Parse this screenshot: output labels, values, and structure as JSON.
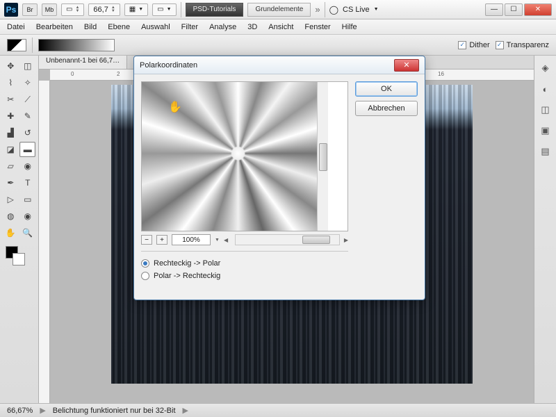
{
  "titlebar": {
    "logo": "Ps",
    "zoom": "66,7",
    "tab_active": "PSD-Tutorials",
    "tab2": "Grundelemente",
    "cslive": "CS Live"
  },
  "menu": [
    "Datei",
    "Bearbeiten",
    "Bild",
    "Ebene",
    "Auswahl",
    "Filter",
    "Analyse",
    "3D",
    "Ansicht",
    "Fenster",
    "Hilfe"
  ],
  "options": {
    "dither_label": "Dither",
    "transp_label": "Transparenz"
  },
  "document": {
    "tab": "Unbenannt-1 bei 66,7…"
  },
  "dialog": {
    "title": "Polarkoordinaten",
    "ok": "OK",
    "cancel": "Abbrechen",
    "zoom": "100%",
    "opt_rect_polar": "Rechteckig -> Polar",
    "opt_polar_rect": "Polar -> Rechteckig"
  },
  "status": {
    "zoom": "66,67%",
    "msg": "Belichtung funktioniert nur bei 32-Bit"
  }
}
